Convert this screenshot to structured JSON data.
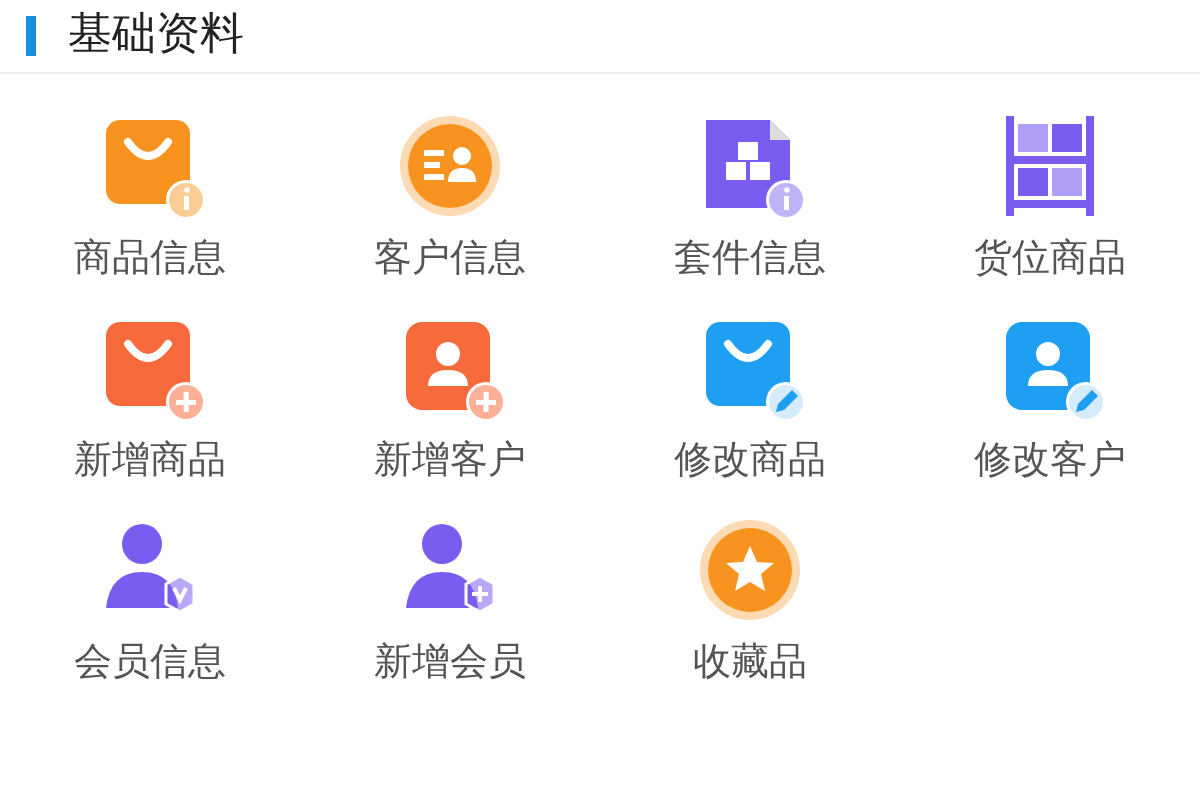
{
  "section": {
    "title": "基础资料"
  },
  "items": [
    {
      "label": "商品信息",
      "kind": "baginfo",
      "color": "#f7931e"
    },
    {
      "label": "客户信息",
      "kind": "contact",
      "color": "#f7931e"
    },
    {
      "label": "套件信息",
      "kind": "cubes",
      "color": "#7b5cf0"
    },
    {
      "label": "货位商品",
      "kind": "shelf",
      "color": "#7b5cf0"
    },
    {
      "label": "新增商品",
      "kind": "bagplus",
      "color": "#f76a3c"
    },
    {
      "label": "新增客户",
      "kind": "personplus",
      "color": "#f76a3c"
    },
    {
      "label": "修改商品",
      "kind": "bagedit",
      "color": "#1e9ff2"
    },
    {
      "label": "修改客户",
      "kind": "personedit",
      "color": "#1e9ff2"
    },
    {
      "label": "会员信息",
      "kind": "membercheck",
      "color": "#7b5cf0"
    },
    {
      "label": "新增会员",
      "kind": "memberplus",
      "color": "#7b5cf0"
    },
    {
      "label": "收藏品",
      "kind": "star",
      "color": "#f7931e"
    }
  ]
}
